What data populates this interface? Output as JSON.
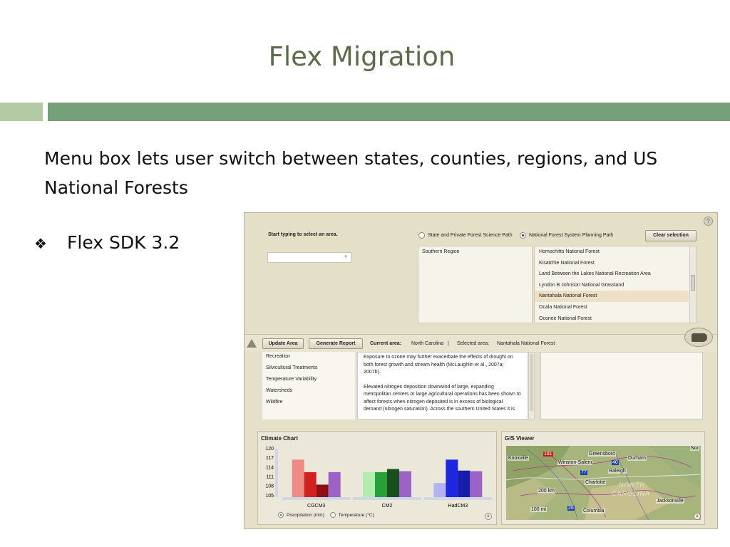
{
  "slide": {
    "title": "Flex Migration",
    "subtitle": "Menu box lets user switch between states, counties, regions, and US National Forests",
    "bullet_glyph": "❖",
    "bullet_text": "Flex SDK 3.2"
  },
  "app": {
    "help_label": "?",
    "select_prompt": "Start typing to select an area.",
    "combo_arrow": "▼",
    "path_options": [
      {
        "label": "State and Private Forest Science Path",
        "selected": false
      },
      {
        "label": "National Forest System Planning Path",
        "selected": true
      }
    ],
    "clear_button": "Clear selection",
    "regions": [
      "Southern Region"
    ],
    "forests": [
      "Homochitto National Forest",
      "Kisatchie National Forest",
      "Land Between the Lakes National Recreation Area",
      "Lyndon B Johnson National Grassland",
      "Nantahala National Forest",
      "Ocala National Forest",
      "Oconee National Forest"
    ],
    "selected_forest": "Nantahala National Forest",
    "toolbar": {
      "update_label": "Update Area",
      "report_label": "Generate Report",
      "current_area_label": "Current area:",
      "current_area_value": "North Carolina",
      "separator": "|",
      "selected_area_label": "Selected area:",
      "selected_area_value": "Nantahala National Forest"
    },
    "topics": [
      "Recreation",
      "Silvicultural Treatments",
      "Temperature Variability",
      "Watersheds",
      "Wildfire"
    ],
    "description": [
      "Exposure to ozone may further exacerbate the effects of drought on both forest growth and stream health (McLaughlin et al., 2007a; 2007b).",
      "Elevated nitrogen deposition downwind of large, expanding metropolitan centers or large agricultural operations has been shown to affect forests when nitrogen deposited is in excess of biological demand (nitrogen saturation). Across the southern United States it is"
    ],
    "climate_chart_title": "Climate Chart",
    "chart_radios": [
      {
        "label": "Precipitation (mm)",
        "selected": true
      },
      {
        "label": "Temperature (°C)",
        "selected": false
      }
    ],
    "plus_label": "+",
    "gis_title": "GIS Viewer",
    "map_labels": {
      "knoxville": "Knoxville",
      "greensboro": "Greensboro",
      "durham": "Durham",
      "winston_salem": "Winston-Salem",
      "raleigh": "Raleigh",
      "charlotte": "Charlotte",
      "north": "NORTH",
      "carolina": "CAROLINA",
      "jacksonville": "Jacksonville",
      "columbia": "Columbia",
      "scale_200": "200 km",
      "scale_100": "100 mi",
      "nor": "Nor",
      "i40": "40",
      "i77": "77",
      "i26": "26",
      "i181": "181"
    }
  },
  "chart_data": {
    "type": "bar",
    "title": "Climate Chart",
    "categories": [
      "CGCM3",
      "CM2",
      "HadCM3"
    ],
    "yticks": [
      120,
      117,
      114,
      111,
      108,
      105
    ],
    "ylim": [
      104.5,
      120
    ],
    "groups": [
      {
        "name": "CGCM3",
        "values": [
          116.5,
          112.5,
          108.5,
          112.5
        ],
        "colors": [
          "#f08a86",
          "#d21f1f",
          "#8e0f12",
          "#9c62c6"
        ]
      },
      {
        "name": "CM2",
        "values": [
          112.5,
          112.5,
          113.5,
          112.8
        ],
        "colors": [
          "#b4ecb0",
          "#26a13a",
          "#17501c",
          "#9c62c6"
        ]
      },
      {
        "name": "HadCM3",
        "values": [
          109,
          116.5,
          113,
          112.8
        ],
        "colors": [
          "#b2b4f0",
          "#1d27e0",
          "#171caa",
          "#9c62c6"
        ]
      }
    ]
  }
}
